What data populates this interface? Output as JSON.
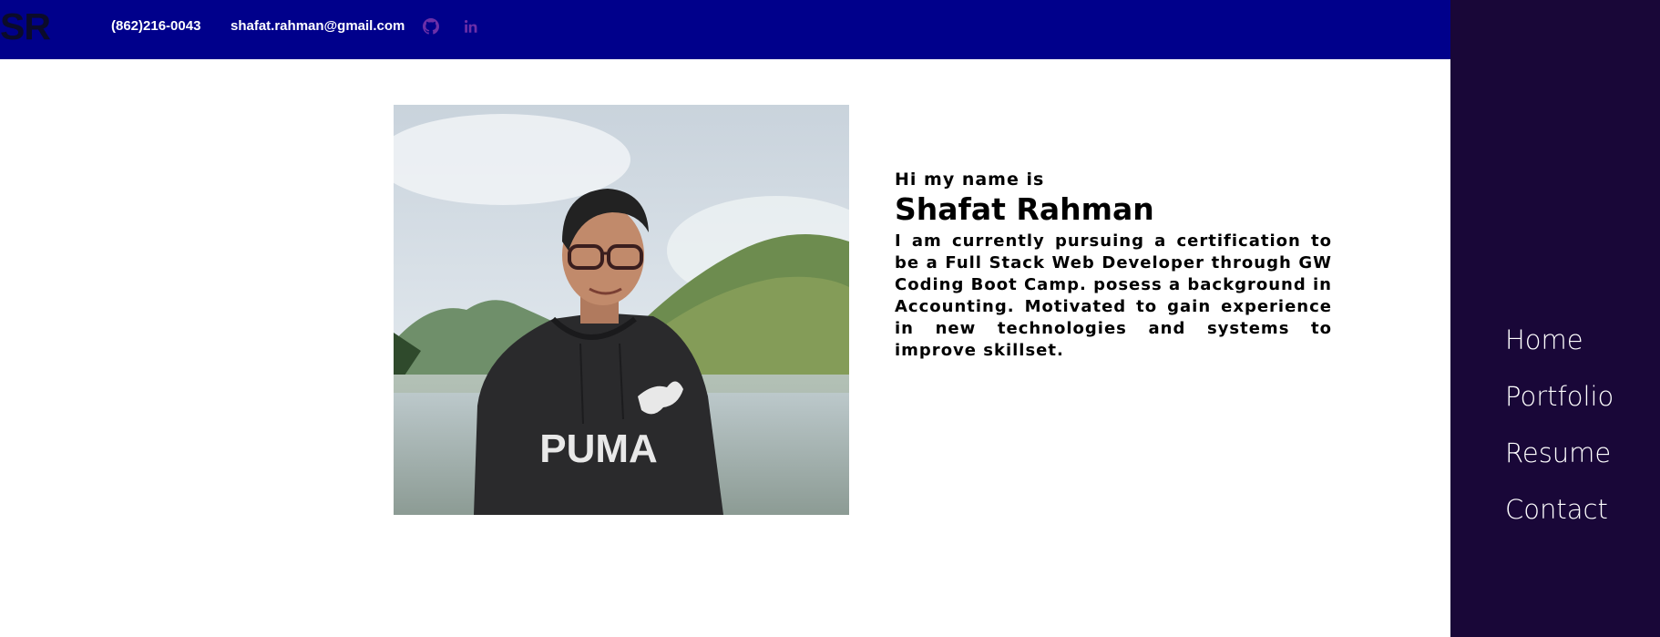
{
  "header": {
    "logo_text": "SR",
    "phone": "(862)216-0043",
    "email": "shafat.rahman@gmail.com",
    "github_icon": "github-icon",
    "linkedin_icon": "linkedin-icon",
    "background_color": "#00008b"
  },
  "sidebar": {
    "background_color": "#190738",
    "items": [
      {
        "label": "Home"
      },
      {
        "label": "Portfolio"
      },
      {
        "label": "Resume"
      },
      {
        "label": "Contact"
      }
    ]
  },
  "intro": {
    "greeting": "Hi my name is",
    "name": "Shafat Rahman",
    "bio": "I am currently pursuing a certification to be a Full Stack Web Developer through GW Coding Boot Camp. posess a background in Accounting. Motivated to gain experience in new technologies and systems to improve skillset."
  },
  "photo": {
    "shirt_text": "PUMA"
  }
}
